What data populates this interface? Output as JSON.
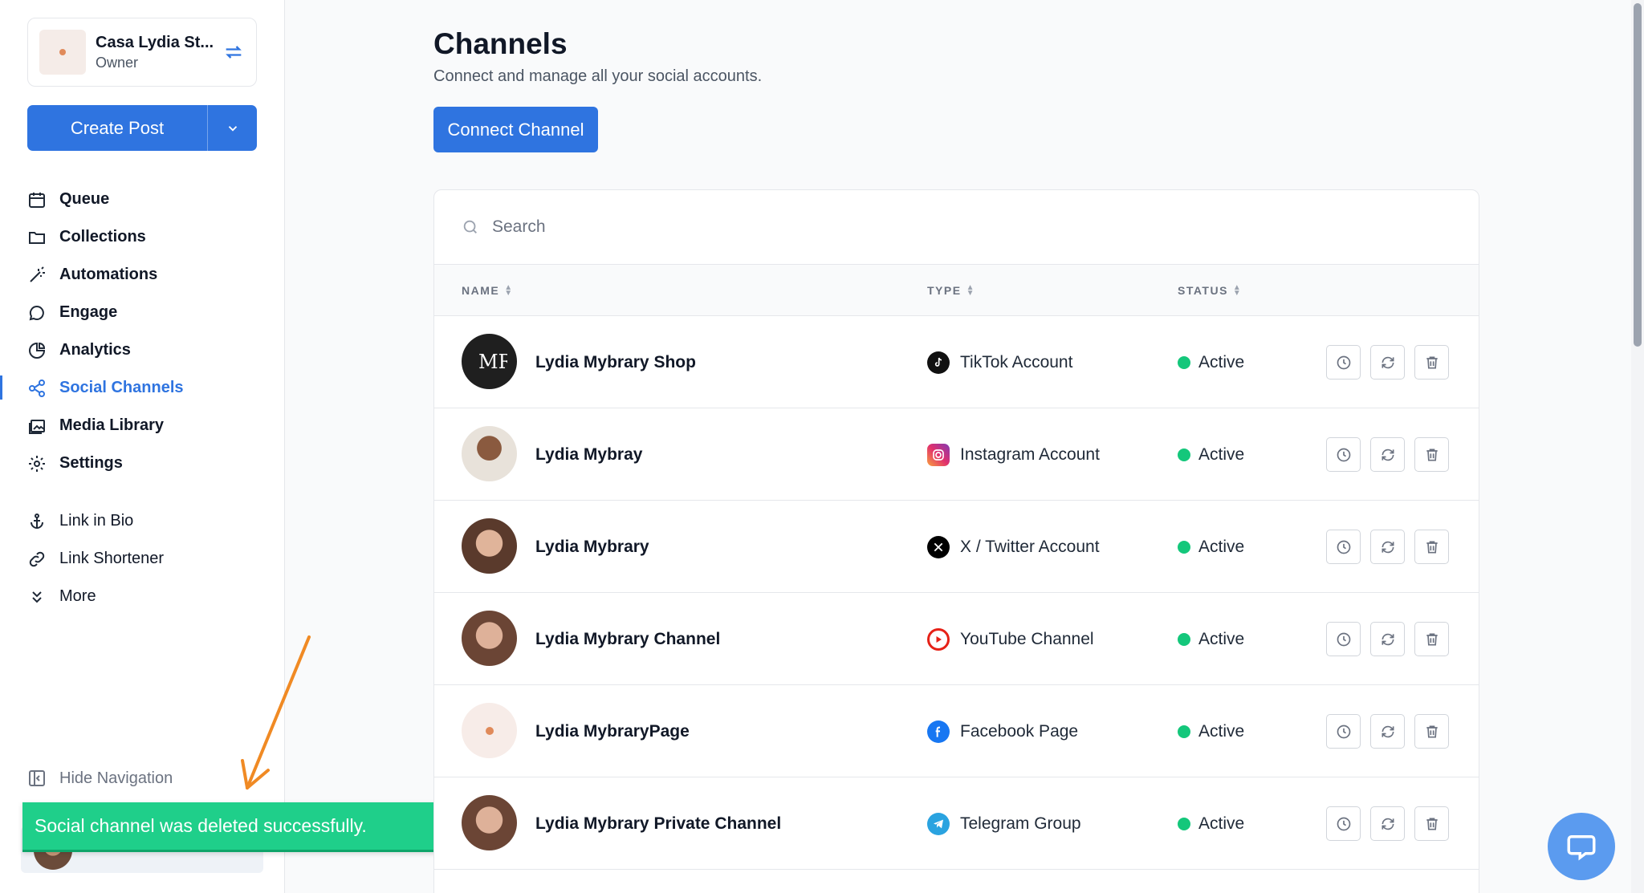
{
  "workspace": {
    "name": "Casa Lydia St...",
    "role": "Owner"
  },
  "create_post": {
    "label": "Create Post"
  },
  "nav": {
    "main": [
      {
        "label": "Queue",
        "icon": "calendar-icon"
      },
      {
        "label": "Collections",
        "icon": "folder-icon"
      },
      {
        "label": "Automations",
        "icon": "wand-icon"
      },
      {
        "label": "Engage",
        "icon": "chat-icon"
      },
      {
        "label": "Analytics",
        "icon": "pie-chart-icon"
      },
      {
        "label": "Social Channels",
        "icon": "share-icon",
        "active": true
      },
      {
        "label": "Media Library",
        "icon": "image-icon"
      },
      {
        "label": "Settings",
        "icon": "gear-icon"
      }
    ],
    "secondary": [
      {
        "label": "Link in Bio",
        "icon": "anchor-icon"
      },
      {
        "label": "Link Shortener",
        "icon": "link-icon"
      },
      {
        "label": "More",
        "icon": "double-chevron-down-icon"
      }
    ],
    "hide_label": "Hide Navigation"
  },
  "toast": {
    "message": "Social channel was deleted successfully."
  },
  "page": {
    "title": "Channels",
    "subtitle": "Connect and manage all your social accounts.",
    "connect_label": "Connect Channel"
  },
  "search": {
    "placeholder": "Search"
  },
  "table": {
    "headers": {
      "name": "NAME",
      "type": "TYPE",
      "status": "STATUS"
    },
    "rows": [
      {
        "name": "Lydia Mybrary Shop",
        "type": "TikTok Account",
        "type_icon": "tiktok-icon",
        "status": "Active"
      },
      {
        "name": "Lydia Mybray",
        "type": "Instagram Account",
        "type_icon": "instagram-icon",
        "status": "Active"
      },
      {
        "name": "Lydia Mybrary",
        "type": "X / Twitter Account",
        "type_icon": "x-twitter-icon",
        "status": "Active"
      },
      {
        "name": "Lydia Mybrary Channel",
        "type": "YouTube Channel",
        "type_icon": "youtube-icon",
        "status": "Active"
      },
      {
        "name": "Lydia MybraryPage",
        "type": "Facebook Page",
        "type_icon": "facebook-icon",
        "status": "Active"
      },
      {
        "name": "Lydia Mybrary Private Channel",
        "type": "Telegram Group",
        "type_icon": "telegram-icon",
        "status": "Active"
      }
    ]
  },
  "colors": {
    "accent": "#2f74e0",
    "status_active": "#14c77b",
    "toast": "#1fcf8a",
    "annotation_arrow": "#f08a24"
  }
}
